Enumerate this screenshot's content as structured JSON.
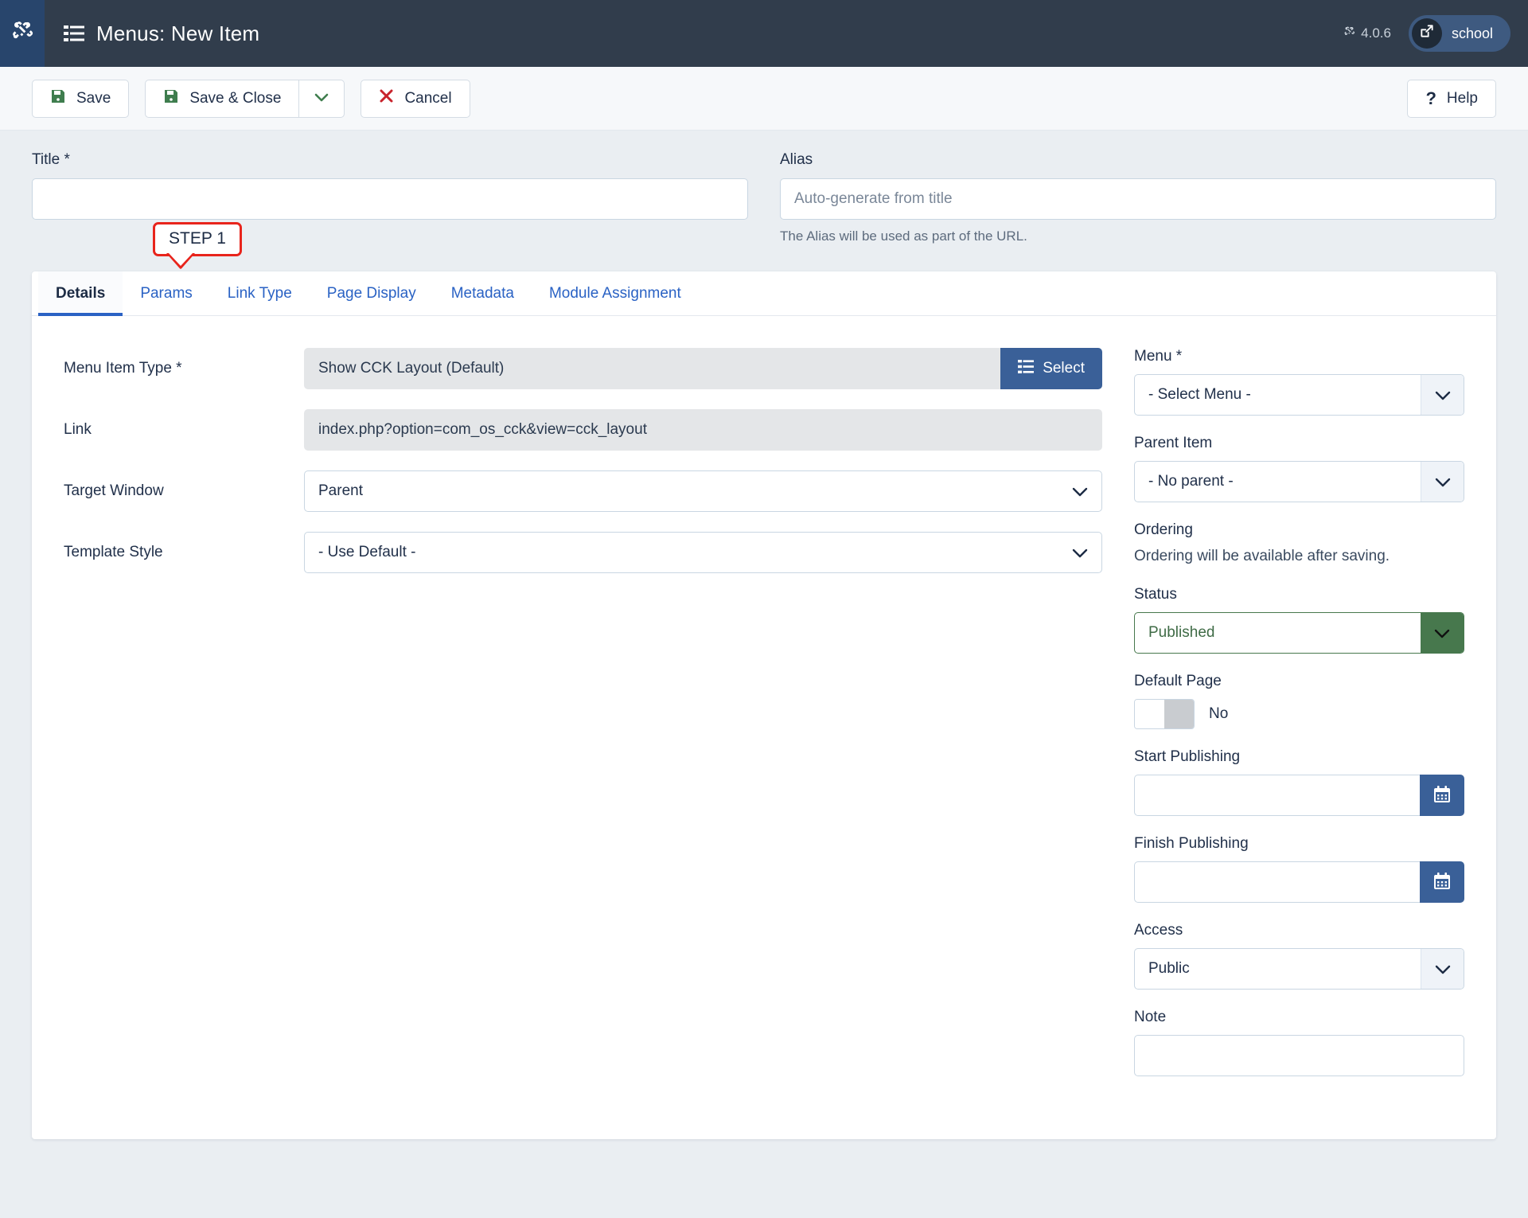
{
  "header": {
    "title": "Menus: New Item",
    "version": "4.0.6",
    "user": "school",
    "logo_icon": "joomla-logo-icon",
    "menu_icon": "list-icon",
    "version_icon": "joomla-mark-icon",
    "avatar_icon": "external-link-icon"
  },
  "toolbar": {
    "save_label": "Save",
    "save_close_label": "Save & Close",
    "save_dropdown_icon": "chevron-down-icon",
    "cancel_label": "Cancel",
    "help_label": "Help",
    "save_icon": "floppy-disk-icon",
    "cancel_icon": "close-x-icon",
    "help_icon": "question-mark-icon"
  },
  "title_row": {
    "title_label": "Title *",
    "title_value": "",
    "title_placeholder": "",
    "alias_label": "Alias",
    "alias_value": "",
    "alias_placeholder": "Auto-generate from title",
    "alias_help": "The Alias will be used as part of the URL."
  },
  "annotation": {
    "step_label": "STEP 1",
    "border_color": "#e8241c"
  },
  "tabs": [
    {
      "label": "Details",
      "active": true
    },
    {
      "label": "Params",
      "active": false
    },
    {
      "label": "Link Type",
      "active": false
    },
    {
      "label": "Page Display",
      "active": false
    },
    {
      "label": "Metadata",
      "active": false
    },
    {
      "label": "Module Assignment",
      "active": false
    }
  ],
  "details": {
    "menu_item_type_label": "Menu Item Type *",
    "menu_item_type_value": "Show CCK Layout (Default)",
    "select_button_label": "Select",
    "select_button_icon": "list-icon",
    "link_label": "Link",
    "link_value": "index.php?option=com_os_cck&view=cck_layout",
    "target_window_label": "Target Window",
    "target_window_value": "Parent",
    "template_style_label": "Template Style",
    "template_style_value": "- Use Default -"
  },
  "sidebar": {
    "menu_label": "Menu *",
    "menu_value": "- Select Menu -",
    "parent_item_label": "Parent Item",
    "parent_item_value": "- No parent -",
    "ordering_label": "Ordering",
    "ordering_note": "Ordering will be available after saving.",
    "status_label": "Status",
    "status_value": "Published",
    "status_color": "#47784d",
    "default_page_label": "Default Page",
    "default_page_value": "No",
    "start_publishing_label": "Start Publishing",
    "start_publishing_value": "",
    "finish_publishing_label": "Finish Publishing",
    "finish_publishing_value": "",
    "calendar_icon": "calendar-icon",
    "access_label": "Access",
    "access_value": "Public",
    "note_label": "Note",
    "note_value": ""
  }
}
